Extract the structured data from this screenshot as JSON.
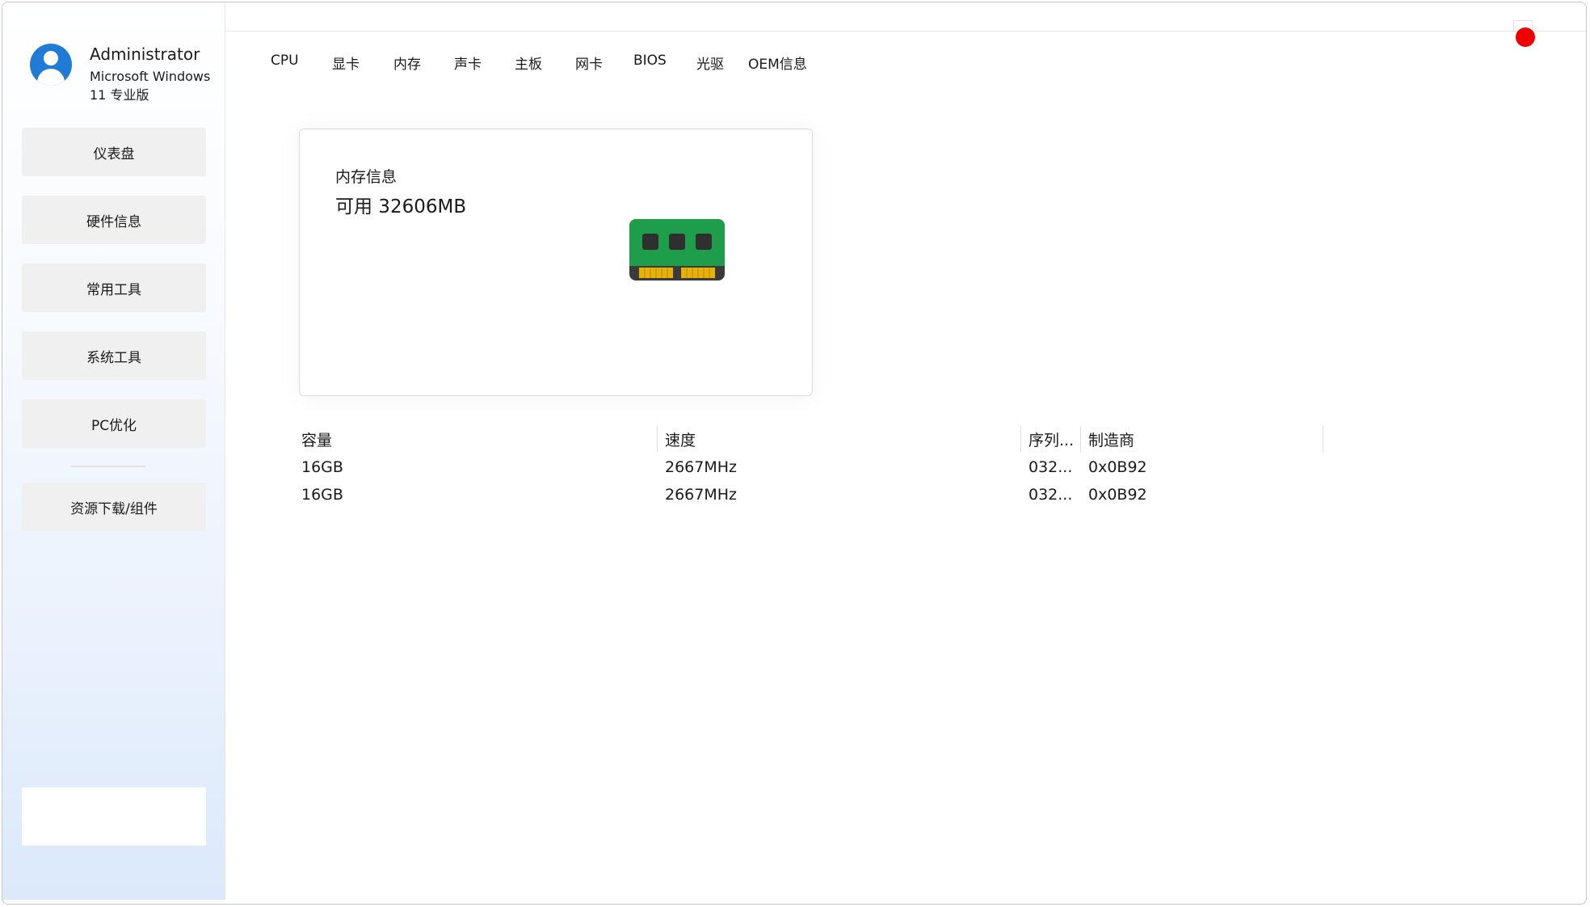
{
  "user": {
    "name": "Administrator",
    "os": "Microsoft Windows 11 专业版"
  },
  "sidebar": {
    "items": [
      {
        "label": "仪表盘"
      },
      {
        "label": "硬件信息"
      },
      {
        "label": "常用工具"
      },
      {
        "label": "系统工具"
      },
      {
        "label": "PC优化"
      },
      {
        "label": "资源下载/组件"
      }
    ]
  },
  "tabs": [
    "CPU",
    "显卡",
    "内存",
    "声卡",
    "主板",
    "网卡",
    "BIOS",
    "光驱",
    "OEM信息"
  ],
  "card": {
    "title": "内存信息",
    "value": "可用 32606MB",
    "icon": "ram-module-icon"
  },
  "table": {
    "columns": [
      "容量",
      "速度",
      "序列...",
      "制造商"
    ],
    "rows": [
      [
        "16GB",
        "2667MHz",
        "032...",
        "0x0B92"
      ],
      [
        "16GB",
        "2667MHz",
        "032...",
        "0x0B92"
      ]
    ]
  },
  "colors": {
    "close": "#ee0000",
    "ram_green": "#1e9e4a",
    "ram_gold": "#e8b300",
    "avatar": "#1f7bd6"
  }
}
